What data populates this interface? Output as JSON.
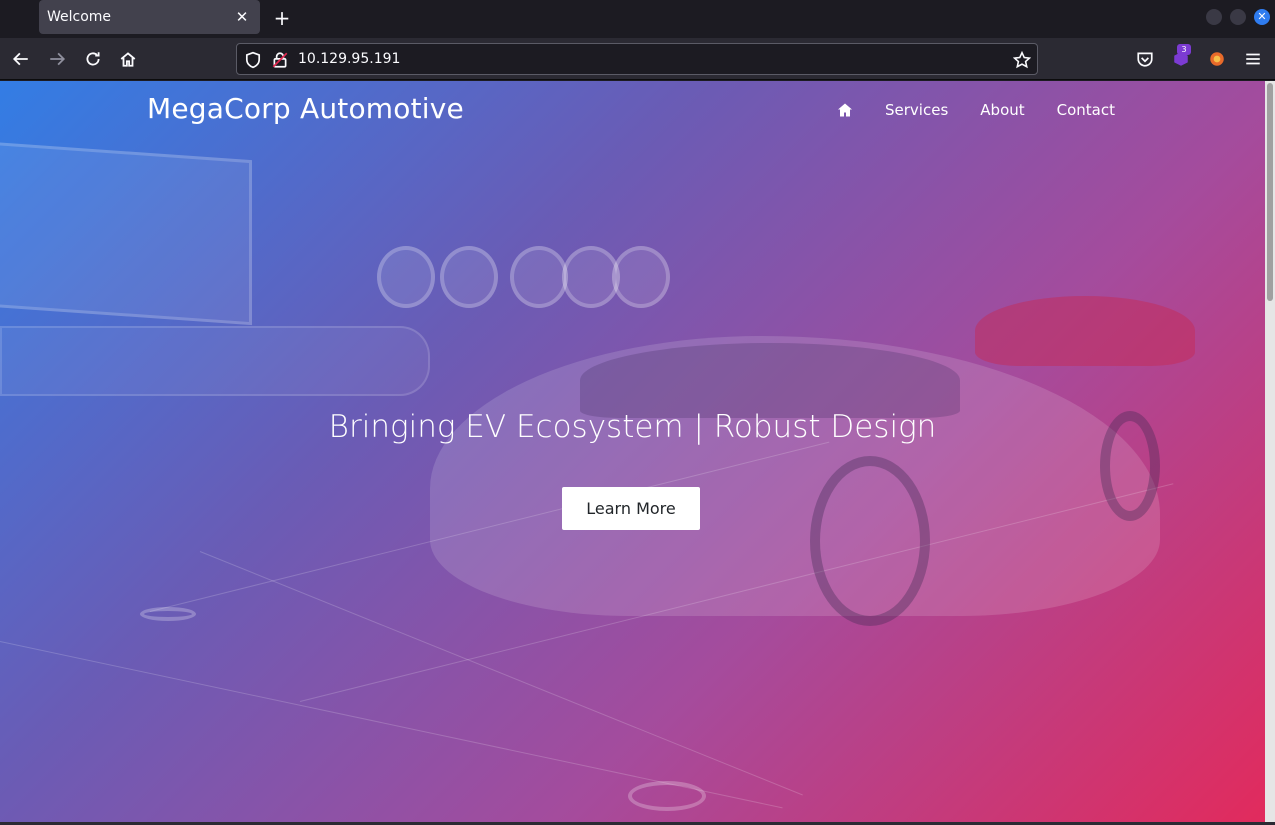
{
  "browser": {
    "tab_title": "Welcome",
    "url": "10.129.95.191",
    "extension_badge": "3",
    "icons": [
      "back-icon",
      "forward-icon",
      "reload-icon",
      "home-icon",
      "shield-icon",
      "insecure-lock-icon",
      "star-icon",
      "pocket-icon",
      "extension-icon",
      "foxyproxy-icon",
      "menu-icon"
    ]
  },
  "site": {
    "brand": "MegaCorp Automotive",
    "nav": {
      "home_icon": "home-icon",
      "items": [
        "Services",
        "About",
        "Contact"
      ]
    },
    "hero": {
      "title": "Bringing EV Ecosystem | Robust Design",
      "button": "Learn More"
    }
  },
  "colors": {
    "gradient_start": "#2e80ec",
    "gradient_end": "#e8285a",
    "button_bg": "#ffffff"
  }
}
